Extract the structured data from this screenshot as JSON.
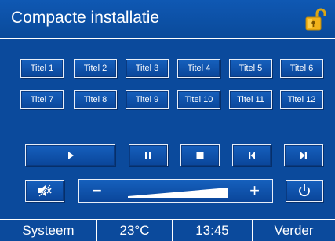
{
  "header": {
    "title": "Compacte installatie",
    "lock_icon": "unlocked-padlock-icon"
  },
  "titles": [
    "Titel 1",
    "Titel 2",
    "Titel 3",
    "Titel 4",
    "Titel 5",
    "Titel 6",
    "Titel 7",
    "Titel 8",
    "Titel 9",
    "Titel 10",
    "Titel 11",
    "Titel 12"
  ],
  "controls": {
    "play_icon": "play-icon",
    "pause_icon": "pause-icon",
    "stop_icon": "stop-icon",
    "previous_icon": "previous-track-icon",
    "next_icon": "next-track-icon",
    "mute_icon": "mute-icon",
    "power_icon": "power-icon"
  },
  "volume": {
    "minus_label": "−",
    "plus_label": "+"
  },
  "footer": {
    "system_label": "Systeem",
    "temperature": "23°C",
    "time": "13:45",
    "next_label": "Verder"
  },
  "colors": {
    "background": "#0b4a9c",
    "text": "#ffffff",
    "lock_gold": "#f2b21a"
  }
}
